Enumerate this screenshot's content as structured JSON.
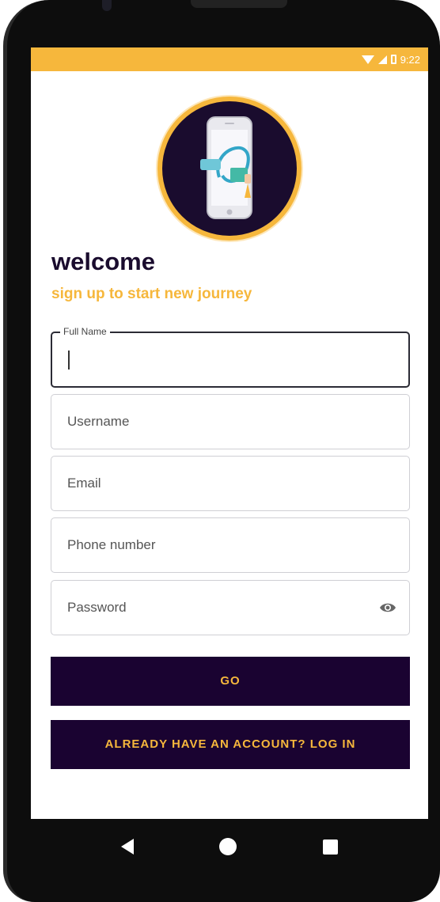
{
  "status_bar": {
    "time": "9:22",
    "icons": [
      "wifi-icon",
      "signal-icon",
      "battery-icon"
    ],
    "color": "#f6b73c"
  },
  "header": {
    "title": "welcome",
    "subtitle": "sign up to start new journey"
  },
  "form": {
    "full_name": {
      "label": "Full Name",
      "value": ""
    },
    "username": {
      "placeholder": "Username"
    },
    "email": {
      "placeholder": "Email"
    },
    "phone": {
      "placeholder": "Phone number"
    },
    "password": {
      "placeholder": "Password",
      "toggle_icon": "eye-icon"
    }
  },
  "buttons": {
    "go": "GO",
    "login": "ALREADY HAVE AN ACCOUNT? LOG IN"
  },
  "navigation": {
    "icons": [
      "back-icon",
      "home-icon",
      "recents-icon"
    ]
  },
  "colors": {
    "accent": "#f6b73c",
    "primary": "#1a0331",
    "title": "#1a0c2e"
  }
}
